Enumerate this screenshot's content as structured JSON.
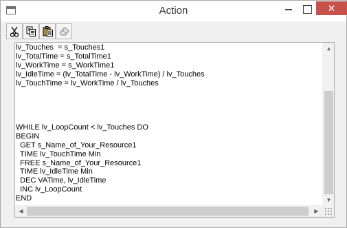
{
  "window": {
    "title": "Action",
    "close_glyph": "✕"
  },
  "toolbar": {
    "items": [
      {
        "name": "cut",
        "icon": "scissors-icon"
      },
      {
        "name": "copy",
        "icon": "copy-icon"
      },
      {
        "name": "paste",
        "icon": "clipboard-icon"
      },
      {
        "name": "erase",
        "icon": "eraser-icon"
      }
    ]
  },
  "editor": {
    "lines": [
      "lv_Touches  = s_Touches1",
      "lv_TotalTime = s_TotalTime1",
      "lv_WorkTime = s_WorkTime1",
      "lv_IdleTime = (lv_TotalTime - lv_WorkTime) / lv_Touches",
      "lv_TouchTime = lv_WorkTime / lv_Touches",
      "",
      "",
      "",
      "",
      "WHILE lv_LoopCount < lv_Touches DO",
      "BEGIN",
      "  GET s_Name_of_Your_Resource1",
      "  TIME lv_TouchTime Min",
      "  FREE s_Name_of_Your_Resource1",
      "  TIME lv_IdleTime Min",
      "  DEC VATime, lv_IdleTime",
      "  INC lv_LoopCount",
      "END"
    ]
  },
  "colors": {
    "close_button": "#c7514b",
    "window_bg": "#f0f0f0",
    "editor_bg": "#ffffff"
  }
}
